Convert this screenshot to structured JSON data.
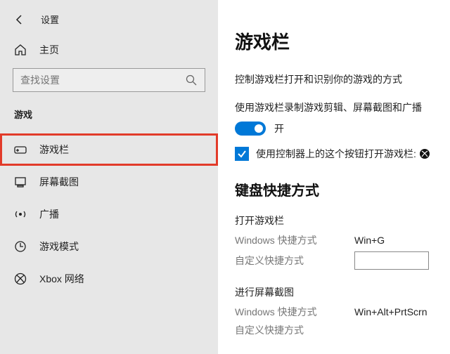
{
  "header": {
    "title": "设置"
  },
  "home": {
    "label": "主页"
  },
  "search": {
    "placeholder": "查找设置"
  },
  "category": "游戏",
  "nav": [
    {
      "label": "游戏栏"
    },
    {
      "label": "屏幕截图"
    },
    {
      "label": "广播"
    },
    {
      "label": "游戏模式"
    },
    {
      "label": "Xbox 网络"
    }
  ],
  "main": {
    "title": "游戏栏",
    "description": "控制游戏栏打开和识别你的游戏的方式",
    "toggle": {
      "label": "使用游戏栏录制游戏剪辑、屏幕截图和广播",
      "state": "开"
    },
    "checkbox": {
      "label": "使用控制器上的这个按钮打开游戏栏:"
    },
    "shortcuts": {
      "heading": "键盘快捷方式",
      "groups": [
        {
          "title": "打开游戏栏",
          "winLabel": "Windows 快捷方式",
          "winValue": "Win+G",
          "customLabel": "自定义快捷方式"
        },
        {
          "title": "进行屏幕截图",
          "winLabel": "Windows 快捷方式",
          "winValue": "Win+Alt+PrtScrn",
          "customLabel": "自定义快捷方式"
        }
      ]
    }
  }
}
